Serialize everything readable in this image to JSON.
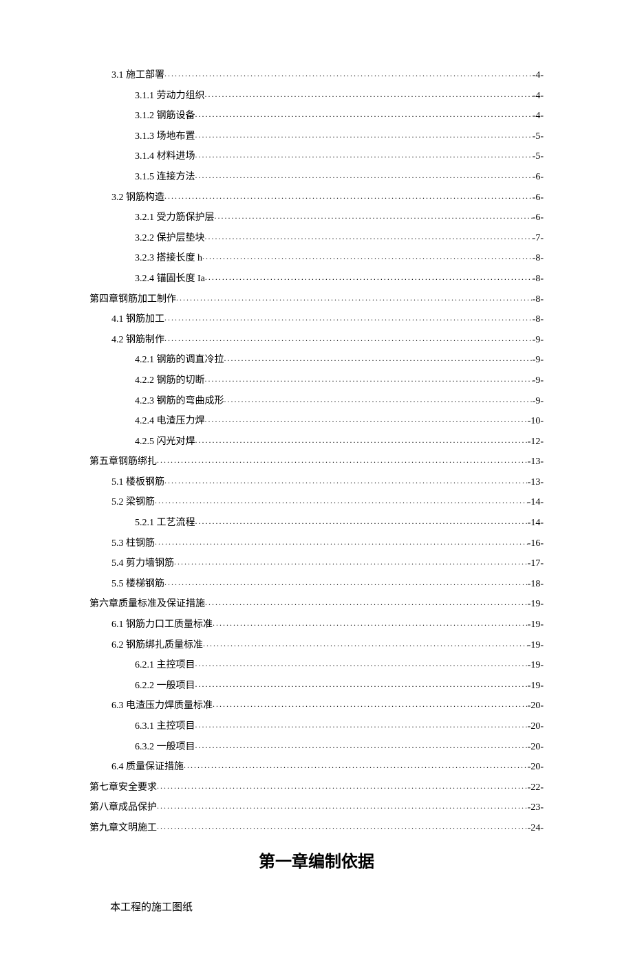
{
  "toc": [
    {
      "indent": 1,
      "num": "3.1",
      "title": "施工部署",
      "page": "-4-"
    },
    {
      "indent": 2,
      "num": "3.1.1",
      "title": "劳动力组织",
      "page": "-4-"
    },
    {
      "indent": 2,
      "num": "3.1.2",
      "title": "钢筋设备",
      "page": "-4-"
    },
    {
      "indent": 2,
      "num": "3.1.3",
      "title": "场地布置",
      "page": "-5-"
    },
    {
      "indent": 2,
      "num": "3.1.4",
      "title": "材料进场",
      "page": "-5-"
    },
    {
      "indent": 2,
      "num": "3.1.5",
      "title": "连接方法",
      "page": "-6-"
    },
    {
      "indent": 1,
      "num": "3.2",
      "title": "钢筋构造",
      "page": "-6-"
    },
    {
      "indent": 2,
      "num": "3.2.1",
      "title": "受力筋保护层",
      "page": "-6-"
    },
    {
      "indent": 2,
      "num": "3.2.2",
      "title": "保护层垫块",
      "page": "-7-"
    },
    {
      "indent": 2,
      "num": "3.2.3",
      "title": "搭接长度 h",
      "page": "-8-"
    },
    {
      "indent": 2,
      "num": "3.2.4",
      "title": "锚固长度 Ia",
      "page": "-8-"
    },
    {
      "indent": 0,
      "num": "",
      "title": "第四章钢筋加工制作",
      "page": "-8-"
    },
    {
      "indent": 1,
      "num": "4.1",
      "title": "钢筋加工",
      "page": "-8-"
    },
    {
      "indent": 1,
      "num": "4.2",
      "title": "钢筋制作",
      "page": "-9-"
    },
    {
      "indent": 2,
      "num": "4.2.1",
      "title": "钢筋的调直冷拉",
      "page": "-9-"
    },
    {
      "indent": 2,
      "num": "4.2.2",
      "title": "钢筋的切断",
      "page": "-9-"
    },
    {
      "indent": 2,
      "num": "4.2.3",
      "title": "钢筋的弯曲成形",
      "page": "-9-"
    },
    {
      "indent": 2,
      "num": "4.2.4",
      "title": "电渣压力焊",
      "page": "-10-"
    },
    {
      "indent": 2,
      "num": "4.2.5",
      "title": "闪光对焊",
      "page": "-12-"
    },
    {
      "indent": 0,
      "num": "",
      "title": "第五章钢筋绑扎",
      "page": "-13-"
    },
    {
      "indent": 1,
      "num": "5.1",
      "title": "楼板钢筋",
      "page": "-13-"
    },
    {
      "indent": 1,
      "num": "5.2",
      "title": "梁钢筋",
      "page": "-14-"
    },
    {
      "indent": 2,
      "num": "5.2.1",
      "title": "工艺流程",
      "page": "-14-"
    },
    {
      "indent": 1,
      "num": "5.3",
      "title": "柱钢筋",
      "page": "-16-"
    },
    {
      "indent": 1,
      "num": "5.4",
      "title": "剪力墙钢筋",
      "page": "-17-"
    },
    {
      "indent": 1,
      "num": "5.5",
      "title": "楼梯钢筋",
      "page": "-18-"
    },
    {
      "indent": 0,
      "num": "",
      "title": "第六章质量标准及保证措施",
      "page": "-19-"
    },
    {
      "indent": 1,
      "num": "6.1",
      "title": "钢筋力口工质量标准",
      "page": "-19-"
    },
    {
      "indent": 1,
      "num": "6.2",
      "title": "钢筋绑扎质量标准",
      "page": "-19-"
    },
    {
      "indent": 2,
      "num": "6.2.1",
      "title": "主控项目",
      "page": "-19-"
    },
    {
      "indent": 2,
      "num": "6.2.2",
      "title": "一般项目",
      "page": "-19-"
    },
    {
      "indent": 1,
      "num": "6.3",
      "title": "电渣压力焊质量标准",
      "page": "-20-"
    },
    {
      "indent": 2,
      "num": "6.3.1",
      "title": "主控项目",
      "page": "-20-"
    },
    {
      "indent": 2,
      "num": "6.3.2",
      "title": "一般项目",
      "page": "-20-"
    },
    {
      "indent": 1,
      "num": "6.4",
      "title": "质量保证措施",
      "page": "-20-"
    },
    {
      "indent": 0,
      "num": "",
      "title": "第七章安全要求",
      "page": "-22-"
    },
    {
      "indent": 0,
      "num": "",
      "title": "第八章成品保护",
      "page": "-23-"
    },
    {
      "indent": 0,
      "num": "",
      "title": "第九章文明施工",
      "page": "-24-"
    }
  ],
  "chapter_title": "第一章编制依据",
  "body_line_1": "本工程的施工图纸"
}
